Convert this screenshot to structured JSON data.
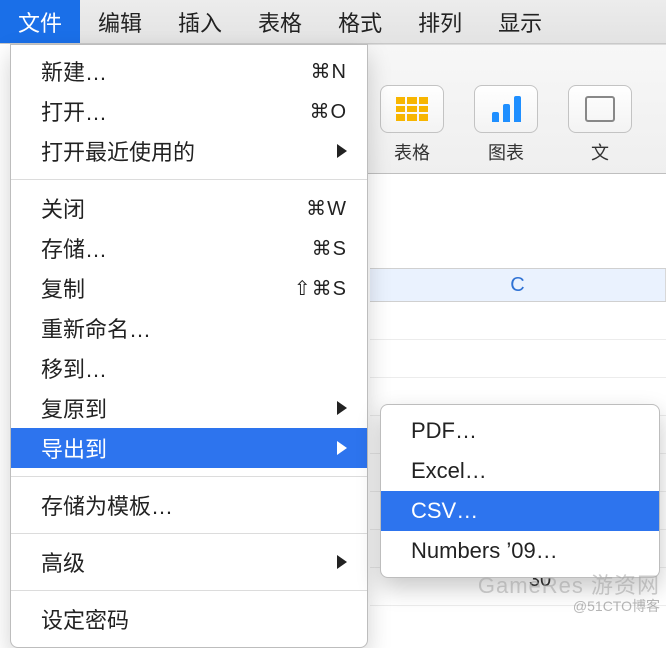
{
  "menubar": {
    "items": [
      {
        "label": "文件",
        "active": true
      },
      {
        "label": "编辑"
      },
      {
        "label": "插入"
      },
      {
        "label": "表格"
      },
      {
        "label": "格式"
      },
      {
        "label": "排列"
      },
      {
        "label": "显示"
      }
    ]
  },
  "toolbar": {
    "tools": [
      {
        "name": "table",
        "label": "表格"
      },
      {
        "name": "chart",
        "label": "图表"
      },
      {
        "name": "text",
        "label": "文"
      }
    ]
  },
  "sheet": {
    "col_header": "C",
    "cell_value": "30"
  },
  "file_menu": {
    "groups": [
      [
        {
          "id": "new",
          "label": "新建…",
          "shortcut": "⌘N"
        },
        {
          "id": "open",
          "label": "打开…",
          "shortcut": "⌘O"
        },
        {
          "id": "recent",
          "label": "打开最近使用的",
          "submenu": true
        }
      ],
      [
        {
          "id": "close",
          "label": "关闭",
          "shortcut": "⌘W"
        },
        {
          "id": "save",
          "label": "存储…",
          "shortcut": "⌘S"
        },
        {
          "id": "dup",
          "label": "复制",
          "shortcut": "⇧⌘S"
        },
        {
          "id": "rename",
          "label": "重新命名…"
        },
        {
          "id": "moveto",
          "label": "移到…"
        },
        {
          "id": "revert",
          "label": "复原到",
          "submenu": true
        },
        {
          "id": "export",
          "label": "导出到",
          "submenu": true,
          "selected": true
        }
      ],
      [
        {
          "id": "savetpl",
          "label": "存储为模板…"
        }
      ],
      [
        {
          "id": "advanced",
          "label": "高级",
          "submenu": true
        }
      ],
      [
        {
          "id": "setpwd",
          "label": "设定密码"
        }
      ]
    ]
  },
  "export_submenu": {
    "items": [
      {
        "id": "pdf",
        "label": "PDF…"
      },
      {
        "id": "excel",
        "label": "Excel…"
      },
      {
        "id": "csv",
        "label": "CSV…",
        "selected": true
      },
      {
        "id": "n09",
        "label": "Numbers ’09…"
      }
    ]
  },
  "watermark": {
    "line1": "GameRes 游资网",
    "line2": "@51CTO博客"
  }
}
